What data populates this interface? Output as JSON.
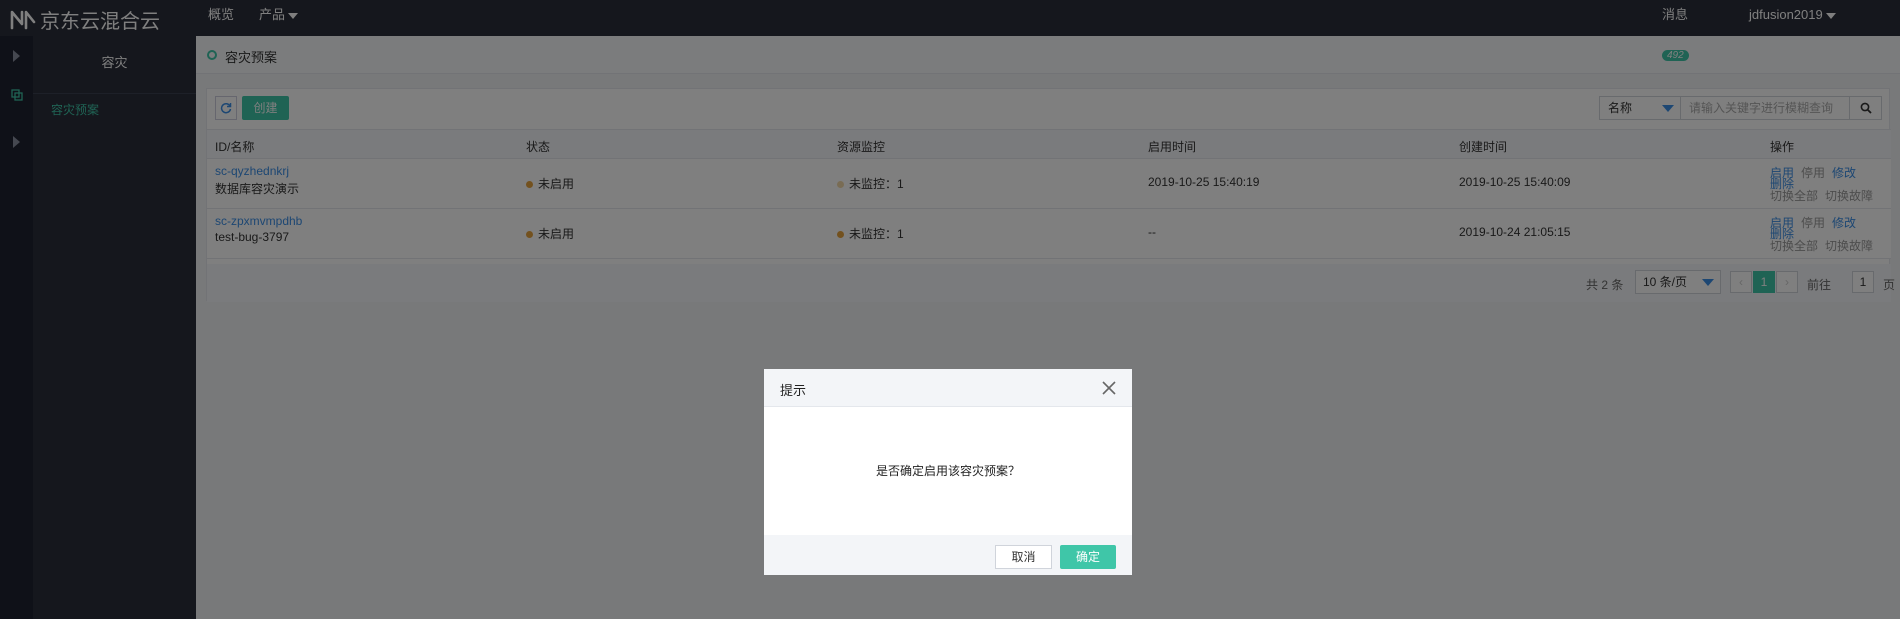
{
  "app": {
    "logo_text": "京东云混合云"
  },
  "topnav": {
    "overview": "概览",
    "products": "产品",
    "messages": "消息",
    "user": "jdfusion2019"
  },
  "sidebar": {
    "title": "容灾",
    "active_item": "容灾预案"
  },
  "page": {
    "title": "容灾预案",
    "badge": "492"
  },
  "toolbar": {
    "create_label": "创建",
    "filter_field": "名称",
    "search_placeholder": "请输入关键字进行模糊查询"
  },
  "table": {
    "columns": [
      "ID/名称",
      "状态",
      "资源监控",
      "启用时间",
      "创建时间",
      "操作"
    ],
    "rows": [
      {
        "id": "sc-qyzhednkrj",
        "name": "数据库容灾演示",
        "status": "未启用",
        "monitor": "未监控：1",
        "enabled_time": "2019-10-25 15:40:19",
        "created_time": "2019-10-25 15:40:09"
      },
      {
        "id": "sc-zpxmvmpdhb",
        "name": "test-bug-3797",
        "status": "未启用",
        "monitor": "未监控：1",
        "enabled_time": "--",
        "created_time": "2019-10-24 21:05:15"
      }
    ],
    "actions": {
      "enable": "启用",
      "disable": "停用",
      "edit": "修改",
      "delete": "删除",
      "switch_all": "切换全部",
      "switch_fault": "切换故障"
    }
  },
  "pagination": {
    "total": "共 2 条",
    "page_size": "10 条/页",
    "prev": "‹",
    "current": "1",
    "next": "›",
    "goto_label": "前往",
    "goto_value": "1",
    "page_suffix": "页"
  },
  "modal": {
    "title": "提示",
    "message": "是否确定启用该容灾预案？",
    "cancel": "取消",
    "confirm": "确定"
  },
  "colors": {
    "accent": "#3fc6a8",
    "link": "#3a8ee6",
    "warning": "#e6a23c",
    "topbar": "#2b2f3a"
  }
}
